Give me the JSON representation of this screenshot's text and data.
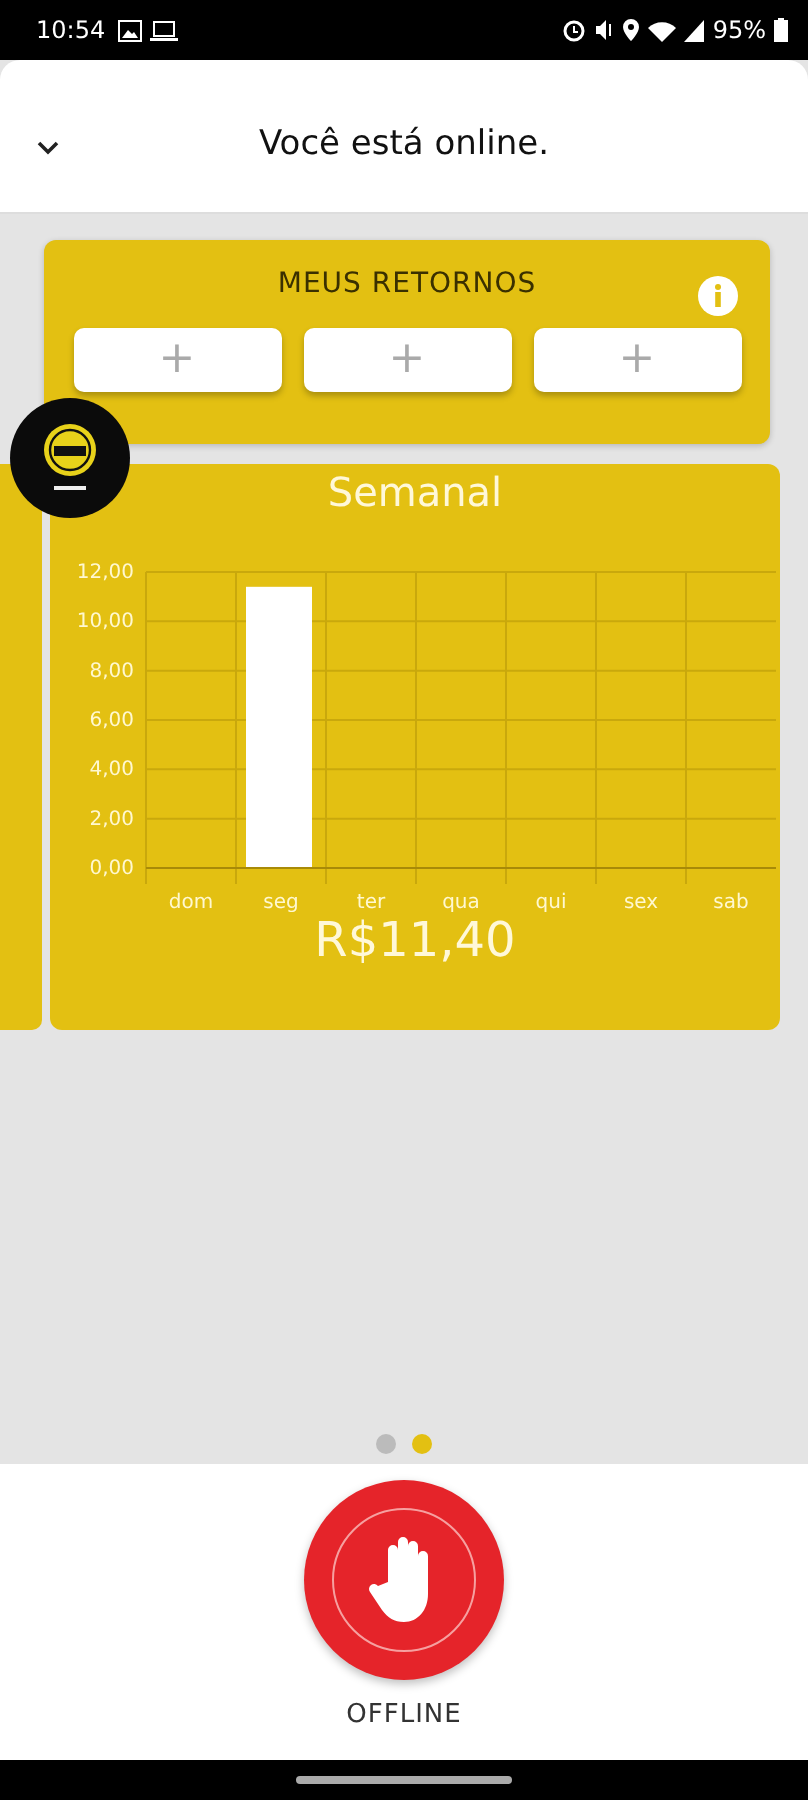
{
  "status_bar": {
    "time": "10:54",
    "battery": "95%"
  },
  "header": {
    "title": "Você está online."
  },
  "returns": {
    "title": "MEUS RETORNOS",
    "slots": [
      "+",
      "+",
      "+"
    ]
  },
  "weekly": {
    "title": "Semanal",
    "total": "R$11,40",
    "chart_data": {
      "type": "bar",
      "grid": true,
      "categories": [
        "dom",
        "seg",
        "ter",
        "qua",
        "qui",
        "sex",
        "sab"
      ],
      "values": [
        0,
        11.4,
        0,
        0,
        0,
        0,
        0
      ],
      "ylim": [
        0,
        12
      ],
      "yticks": [
        {
          "value": 0,
          "label": "0,00"
        },
        {
          "value": 2,
          "label": "2,00"
        },
        {
          "value": 4,
          "label": "4,00"
        },
        {
          "value": 6,
          "label": "6,00"
        },
        {
          "value": 8,
          "label": "8,00"
        },
        {
          "value": 10,
          "label": "10,00"
        },
        {
          "value": 12,
          "label": "12,00"
        }
      ]
    }
  },
  "pager": [
    {
      "selected": false
    },
    {
      "selected": true
    }
  ],
  "offline_button": {
    "label": "OFFLINE"
  }
}
